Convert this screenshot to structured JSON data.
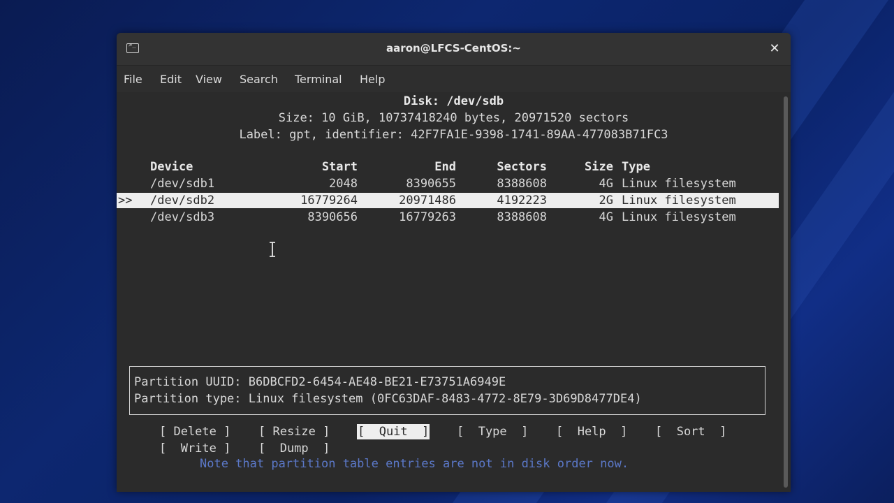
{
  "window": {
    "title": "aaron@LFCS-CentOS:~",
    "icon": "terminal-icon",
    "close_label": "✕"
  },
  "menu": {
    "items": [
      "File",
      "Edit",
      "View",
      "Search",
      "Terminal",
      "Help"
    ]
  },
  "disk": {
    "name_line": "Disk: /dev/sdb",
    "size_line": "Size: 10 GiB, 10737418240 bytes, 20971520 sectors",
    "label_line": "Label: gpt, identifier: 42F7FA1E-9398-1741-89AA-477083B71FC3"
  },
  "table": {
    "headers": {
      "device": "Device",
      "start": "Start",
      "end": "End",
      "sectors": "Sectors",
      "size": "Size",
      "type": "Type"
    },
    "rows": [
      {
        "marker": "",
        "device": "/dev/sdb1",
        "start": "2048",
        "end": "8390655",
        "sectors": "8388608",
        "size": "4G",
        "type": "Linux filesystem"
      },
      {
        "marker": ">>",
        "device": "/dev/sdb2",
        "start": "16779264",
        "end": "20971486",
        "sectors": "4192223",
        "size": "2G",
        "type": "Linux filesystem"
      },
      {
        "marker": "",
        "device": "/dev/sdb3",
        "start": "8390656",
        "end": "16779263",
        "sectors": "8388608",
        "size": "4G",
        "type": "Linux filesystem"
      }
    ],
    "selected_index": 1
  },
  "info": {
    "uuid_line": "Partition UUID: B6DBCFD2-6454-AE48-BE21-E73751A6949E",
    "type_line": "Partition type: Linux filesystem (0FC63DAF-8483-4772-8E79-3D69D8477DE4)"
  },
  "actions": {
    "delete": "[ Delete ]",
    "resize": "[ Resize ]",
    "quit": "[  Quit  ]",
    "type": "[  Type  ]",
    "help": "[  Help  ]",
    "sort": "[  Sort  ]",
    "write": "[  Write ]",
    "dump": "[  Dump  ]",
    "active": "quit"
  },
  "note": "Note that partition table entries are not in disk order now.",
  "colors": {
    "terminal_bg": "#2b2b2b",
    "highlight_bg": "#eeeeee",
    "note_text": "#5b78c8"
  }
}
